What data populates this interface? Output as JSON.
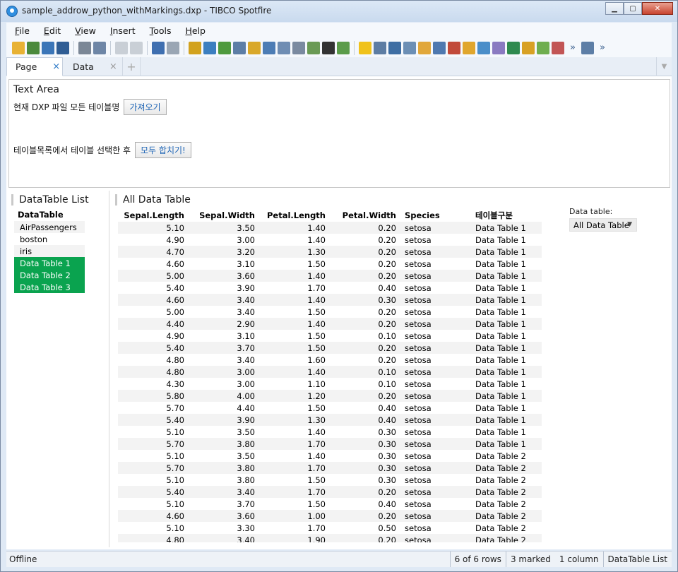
{
  "window": {
    "title": "sample_addrow_python_withMarkings.dxp - TIBCO Spotfire",
    "minimize": "▁",
    "maximize": "▢",
    "close": "✕"
  },
  "menu": {
    "items": [
      {
        "label": "File",
        "mnemonic": "F",
        "rest": "ile"
      },
      {
        "label": "Edit",
        "mnemonic": "E",
        "rest": "dit"
      },
      {
        "label": "View",
        "mnemonic": "V",
        "rest": "iew"
      },
      {
        "label": "Insert",
        "mnemonic": "I",
        "rest": "nsert"
      },
      {
        "label": "Tools",
        "mnemonic": "T",
        "rest": "ools"
      },
      {
        "label": "Help",
        "mnemonic": "H",
        "rest": "elp"
      }
    ]
  },
  "toolbar": {
    "overflow": "»"
  },
  "tabs": {
    "page": "Page",
    "data": "Data",
    "close": "×",
    "add": "+",
    "dropdown": "▼"
  },
  "text_area": {
    "title": "Text Area",
    "row1_label": "현재 DXP 파일 모든 테이블명",
    "row1_button": "가져오기",
    "row2_label": "테이블목록에서 테이블 선택한 후",
    "row2_button": "모두 합치기!"
  },
  "datatable_list": {
    "title": "DataTable List",
    "header": "DataTable",
    "items": [
      {
        "label": "AirPassengers",
        "selected": false
      },
      {
        "label": "boston",
        "selected": false
      },
      {
        "label": "iris",
        "selected": false
      },
      {
        "label": "Data Table 1",
        "selected": true
      },
      {
        "label": "Data Table 2",
        "selected": true
      },
      {
        "label": "Data Table 3",
        "selected": true
      }
    ]
  },
  "all_data_table": {
    "title": "All Data Table",
    "columns": [
      "Sepal.Length",
      "Sepal.Width",
      "Petal.Length",
      "Petal.Width",
      "Species",
      "테이블구분"
    ],
    "rows": [
      [
        "5.10",
        "3.50",
        "1.40",
        "0.20",
        "setosa",
        "Data Table 1"
      ],
      [
        "4.90",
        "3.00",
        "1.40",
        "0.20",
        "setosa",
        "Data Table 1"
      ],
      [
        "4.70",
        "3.20",
        "1.30",
        "0.20",
        "setosa",
        "Data Table 1"
      ],
      [
        "4.60",
        "3.10",
        "1.50",
        "0.20",
        "setosa",
        "Data Table 1"
      ],
      [
        "5.00",
        "3.60",
        "1.40",
        "0.20",
        "setosa",
        "Data Table 1"
      ],
      [
        "5.40",
        "3.90",
        "1.70",
        "0.40",
        "setosa",
        "Data Table 1"
      ],
      [
        "4.60",
        "3.40",
        "1.40",
        "0.30",
        "setosa",
        "Data Table 1"
      ],
      [
        "5.00",
        "3.40",
        "1.50",
        "0.20",
        "setosa",
        "Data Table 1"
      ],
      [
        "4.40",
        "2.90",
        "1.40",
        "0.20",
        "setosa",
        "Data Table 1"
      ],
      [
        "4.90",
        "3.10",
        "1.50",
        "0.10",
        "setosa",
        "Data Table 1"
      ],
      [
        "5.40",
        "3.70",
        "1.50",
        "0.20",
        "setosa",
        "Data Table 1"
      ],
      [
        "4.80",
        "3.40",
        "1.60",
        "0.20",
        "setosa",
        "Data Table 1"
      ],
      [
        "4.80",
        "3.00",
        "1.40",
        "0.10",
        "setosa",
        "Data Table 1"
      ],
      [
        "4.30",
        "3.00",
        "1.10",
        "0.10",
        "setosa",
        "Data Table 1"
      ],
      [
        "5.80",
        "4.00",
        "1.20",
        "0.20",
        "setosa",
        "Data Table 1"
      ],
      [
        "5.70",
        "4.40",
        "1.50",
        "0.40",
        "setosa",
        "Data Table 1"
      ],
      [
        "5.40",
        "3.90",
        "1.30",
        "0.40",
        "setosa",
        "Data Table 1"
      ],
      [
        "5.10",
        "3.50",
        "1.40",
        "0.30",
        "setosa",
        "Data Table 1"
      ],
      [
        "5.70",
        "3.80",
        "1.70",
        "0.30",
        "setosa",
        "Data Table 1"
      ],
      [
        "5.10",
        "3.50",
        "1.40",
        "0.30",
        "setosa",
        "Data Table 2"
      ],
      [
        "5.70",
        "3.80",
        "1.70",
        "0.30",
        "setosa",
        "Data Table 2"
      ],
      [
        "5.10",
        "3.80",
        "1.50",
        "0.30",
        "setosa",
        "Data Table 2"
      ],
      [
        "5.40",
        "3.40",
        "1.70",
        "0.20",
        "setosa",
        "Data Table 2"
      ],
      [
        "5.10",
        "3.70",
        "1.50",
        "0.40",
        "setosa",
        "Data Table 2"
      ],
      [
        "4.60",
        "3.60",
        "1.00",
        "0.20",
        "setosa",
        "Data Table 2"
      ],
      [
        "5.10",
        "3.30",
        "1.70",
        "0.50",
        "setosa",
        "Data Table 2"
      ],
      [
        "4.80",
        "3.40",
        "1.90",
        "0.20",
        "setosa",
        "Data Table 2"
      ]
    ]
  },
  "data_table_selector": {
    "label": "Data table:",
    "value": "All Data Table",
    "arrow": "▼"
  },
  "status": {
    "left": "Offline",
    "rows": "6 of 6 rows",
    "marked": "3 marked",
    "columns": "1 column",
    "table": "DataTable List"
  },
  "colors": {
    "selected_green": "#0aa34f",
    "link_blue": "#1d64b5"
  }
}
